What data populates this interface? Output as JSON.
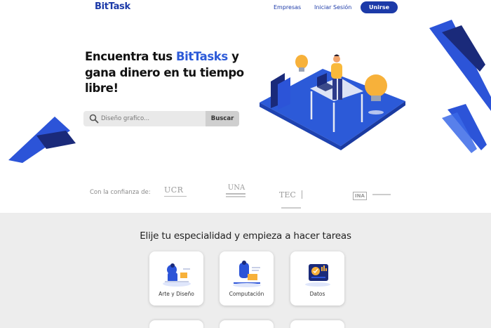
{
  "nav": {
    "logo": "BitTask",
    "links": [
      "Empresas",
      "Iniciar Sesión"
    ],
    "join_label": "Unirse"
  },
  "hero": {
    "headline_before": "Encuentra tus ",
    "headline_accent": "BitTasks",
    "headline_after": " y gana dinero en tu tiempo libre!",
    "search_placeholder": "Diseño grafico...",
    "search_button": "Buscar"
  },
  "trust": {
    "label": "Con la confianza de:",
    "partners": [
      {
        "name": "UCR",
        "icon": "ucr-logo"
      },
      {
        "name": "UNA",
        "icon": "una-logo"
      },
      {
        "name": "TEC",
        "icon": "tec-logo"
      },
      {
        "name": "INA",
        "icon": "ina-logo"
      }
    ]
  },
  "specialties": {
    "title": "Elije tu especialidad y empieza a hacer tareas",
    "cards": [
      {
        "label": "Arte y Diseño",
        "icon": "art-design-illustration"
      },
      {
        "label": "Computación",
        "icon": "computing-illustration"
      },
      {
        "label": "Datos",
        "icon": "data-illustration"
      }
    ]
  },
  "colors": {
    "brand": "#1c3aa8",
    "accent": "#2c5ad8",
    "section_bg": "#ededed"
  }
}
